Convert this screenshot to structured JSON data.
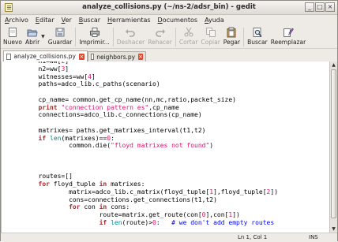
{
  "window": {
    "title": "analyze_collisions.py (~/ns-2/adsr_bin) - gedit",
    "buttons": [
      "_",
      "□",
      "×"
    ]
  },
  "menubar": [
    {
      "underline": "A",
      "rest": "rchivo"
    },
    {
      "underline": "E",
      "rest": "ditar"
    },
    {
      "underline": "V",
      "rest": "er"
    },
    {
      "underline": "B",
      "rest": "uscar"
    },
    {
      "underline": "H",
      "rest": "erramientas"
    },
    {
      "underline": "D",
      "rest": "ocumentos"
    },
    {
      "underline": "A",
      "rest": "yuda"
    }
  ],
  "toolbar": {
    "nuevo": "Nuevo",
    "abrir": "Abrir",
    "guardar": "Guardar",
    "imprimir": "Imprimir...",
    "deshacer": "Deshacer",
    "rehacer": "Rehacer",
    "cortar": "Cortar",
    "copiar": "Copiar",
    "pegar": "Pegar",
    "buscar": "Buscar",
    "reemplazar": "Reemplazar"
  },
  "tabs": [
    {
      "label": "analyze_collisions.py",
      "active": true
    },
    {
      "label": "neighbors.py",
      "active": false
    }
  ],
  "status": {
    "position": "Ln 1, Col 1",
    "mode": "INS"
  }
}
